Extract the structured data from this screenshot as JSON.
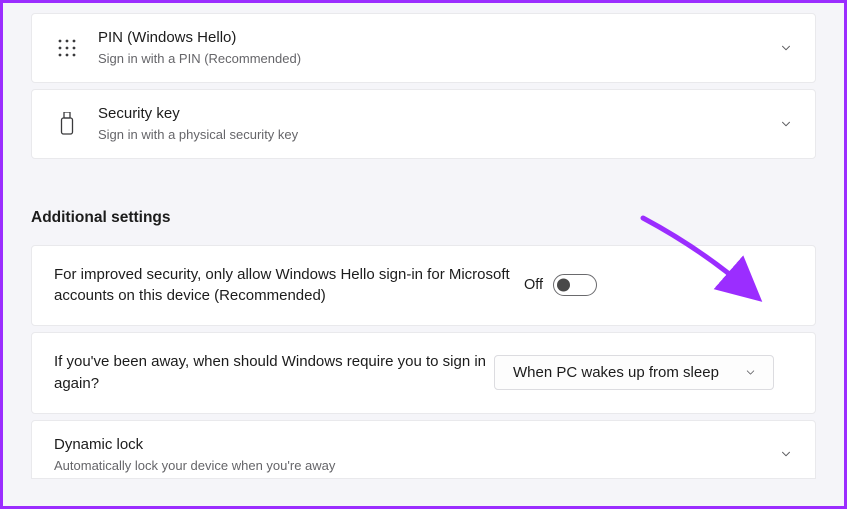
{
  "signin_options": [
    {
      "title": "PIN (Windows Hello)",
      "subtitle": "Sign in with a PIN (Recommended)"
    },
    {
      "title": "Security key",
      "subtitle": "Sign in with a physical security key"
    }
  ],
  "section_header": "Additional settings",
  "hello_only": {
    "text": "For improved security, only allow Windows Hello sign-in for Microsoft accounts on this device (Recommended)",
    "state_label": "Off"
  },
  "require_signin": {
    "text": "If you've been away, when should Windows require you to sign in again?",
    "selected": "When PC wakes up from sleep"
  },
  "dynamic_lock": {
    "title": "Dynamic lock",
    "subtitle": "Automatically lock your device when you're away"
  },
  "colors": {
    "annotation": "#9b2dff"
  }
}
